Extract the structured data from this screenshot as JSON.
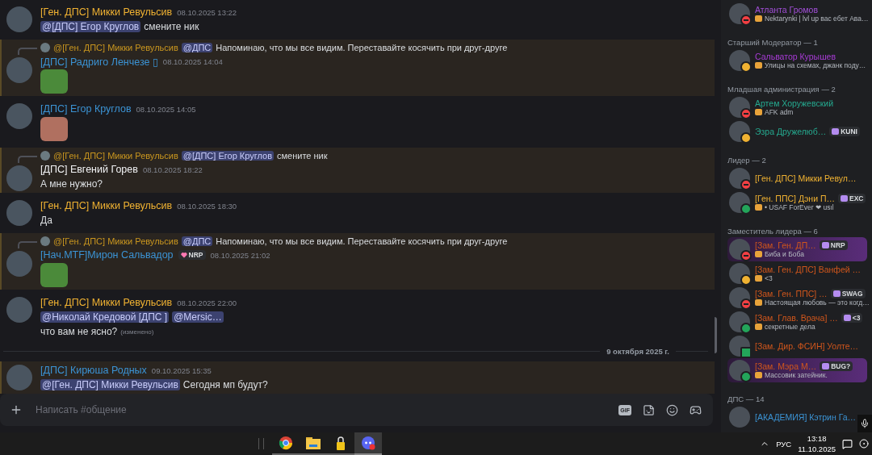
{
  "chat": {
    "messages": [
      {
        "kind": "message",
        "highlighted": false,
        "author": "[Ген. ДПС] Микки Ревульсив",
        "color": "#f0b232",
        "time": "08.10.2025 13:22",
        "lines": [
          [
            {
              "kind": "mention",
              "text": "@[ДПС] Егор Круглов"
            },
            {
              "kind": "text",
              "text": "смените ник"
            }
          ]
        ]
      },
      {
        "kind": "message",
        "highlighted": true,
        "reply": {
          "author": "@[Ген. ДПС] Микки Ревульсив",
          "color": "#c9961f",
          "parts": [
            {
              "kind": "mention",
              "text": "@ДПС"
            },
            {
              "kind": "text",
              "text": "Напоминаю, что мы все видим. Переставайте косячить при друг-друге"
            }
          ]
        },
        "author": "[ДПС] Радриго Ленчезе ▯",
        "color": "#3b93d4",
        "time": "08.10.2025 14:04",
        "lines": [
          [
            {
              "kind": "sticker"
            }
          ]
        ]
      },
      {
        "kind": "message",
        "highlighted": false,
        "author": "[ДПС] Егор Круглов",
        "color": "#3b93d4",
        "time": "08.10.2025 14:05",
        "lines": [
          [
            {
              "kind": "photo"
            }
          ]
        ]
      },
      {
        "kind": "message",
        "highlighted": true,
        "reply": {
          "author": "@[Ген. ДПС] Микки Ревульсив",
          "color": "#c9961f",
          "parts": [
            {
              "kind": "mention",
              "text": "@[ДПС] Егор Круглов"
            },
            {
              "kind": "text",
              "text": "смените ник"
            }
          ]
        },
        "author": "[ДПС] Евгений Горев",
        "color": "#f2f3f5",
        "time": "08.10.2025 18:22",
        "lines": [
          [
            {
              "kind": "text",
              "text": "А мне нужно?"
            }
          ]
        ]
      },
      {
        "kind": "message",
        "highlighted": false,
        "author": "[Ген. ДПС] Микки Ревульсив",
        "color": "#f0b232",
        "time": "08.10.2025 18:30",
        "lines": [
          [
            {
              "kind": "text",
              "text": "Да"
            }
          ]
        ]
      },
      {
        "kind": "message",
        "highlighted": true,
        "reply": {
          "author": "@[Ген. ДПС] Микки Ревульсив",
          "color": "#c9961f",
          "parts": [
            {
              "kind": "mention",
              "text": "@ДПС"
            },
            {
              "kind": "text",
              "text": "Напоминаю, что мы все видим. Переставайте косячить при друг-друге"
            }
          ]
        },
        "author": "[Нач.MTF]Мирон Сальвадор",
        "color": "#3b93d4",
        "badge": "NRP",
        "time": "08.10.2025 21:02",
        "lines": [
          [
            {
              "kind": "sticker"
            }
          ]
        ]
      },
      {
        "kind": "message",
        "highlighted": false,
        "author": "[Ген. ДПС] Микки Ревульсив",
        "color": "#f0b232",
        "time": "08.10.2025 22:00",
        "lines": [
          [
            {
              "kind": "mention",
              "text": "@Николай Кредовой [ДПС ]"
            },
            {
              "kind": "mention",
              "text": "@Mersic…"
            }
          ],
          [
            {
              "kind": "text",
              "text": "что вам не ясно?"
            },
            {
              "kind": "edited",
              "text": "(изменено)"
            }
          ]
        ]
      },
      {
        "kind": "divider",
        "label": "9 октября 2025 г."
      },
      {
        "kind": "message",
        "highlighted": true,
        "author": "[ДПС] Кирюша Родных",
        "color": "#3b93d4",
        "time": "09.10.2025 15:35",
        "lines": [
          [
            {
              "kind": "mention",
              "text": "@[Ген. ДПС] Микки Ревульсив"
            },
            {
              "kind": "text",
              "text": "Сегодня мп будут?"
            }
          ]
        ]
      }
    ],
    "input": {
      "placeholder": "Написать #общение",
      "gif_label": "GIF"
    }
  },
  "member_list": {
    "sections": [
      {
        "members": [
          {
            "name": "Атланта Громов",
            "color": "#a24fd8",
            "status": "Nektarynki | lvl up вас ебет Ава…",
            "kind": "dnd",
            "highlighted": false
          }
        ]
      },
      {
        "title": "Старший Модератор — 1",
        "members": [
          {
            "name": "Сальватор Курышев",
            "color": "#a83bd6",
            "status": "Улицы на схемах, джанк поду…",
            "kind": "idle",
            "highlighted": false
          }
        ]
      },
      {
        "title": "Младшая администрация — 2",
        "members": [
          {
            "name": "Артем Хоружевский",
            "color": "#25a98f",
            "status": "AFK adm",
            "kind": "dnd",
            "highlighted": false
          },
          {
            "name": "Эзра Дружелюб…",
            "color": "#25a98f",
            "badge": "KUNI",
            "kind": "idle",
            "highlighted": false
          }
        ]
      },
      {
        "title": "Лидер — 2",
        "members": [
          {
            "name": "[Ген. ДПС] Микки Ревул…",
            "color": "#f0b232",
            "kind": "dnd",
            "highlighted": false
          },
          {
            "name": "[Ген. ППС] Дэни П…",
            "color": "#f0b232",
            "badge": "EXC",
            "status": "• USAF ForEver ❤ usıl",
            "kind": "online",
            "highlighted": false
          }
        ]
      },
      {
        "title": "Заместитель лидера — 6",
        "members": [
          {
            "name": "[Зам. Ген. ДП…",
            "color": "#d0561c",
            "badge": "NRP",
            "status": "Биба и Боба",
            "kind": "dnd",
            "highlighted": true
          },
          {
            "name": "[Зам. Ген. ДПС] Ванфей …",
            "color": "#d0561c",
            "status": "<3",
            "kind": "idle",
            "highlighted": false
          },
          {
            "name": "[Зам. Ген. ППС] …",
            "color": "#d0561c",
            "badge": "SWAG",
            "status": "Настоящая любовь — это когд…",
            "kind": "dnd",
            "highlighted": false
          },
          {
            "name": "[Зам. Глав. Врача] …",
            "color": "#d0561c",
            "badge": "<3",
            "status": "секретные дела",
            "kind": "online",
            "highlighted": false
          },
          {
            "name": "[Зам. Дир. ФСИН] Уолте…",
            "color": "#d0561c",
            "kind": "mobile",
            "highlighted": false
          },
          {
            "name": "[Зам. Мэра М…",
            "color": "#d0561c",
            "badge": "BUG?",
            "status": "Массовик затейник.",
            "kind": "online",
            "highlighted": true
          }
        ]
      },
      {
        "title": "ДПС — 14",
        "members": [
          {
            "name": "[АКАДЕМИЯ] Кэтрин Га…",
            "color": "#3b93d4",
            "kind": "none",
            "highlighted": false
          }
        ]
      }
    ]
  },
  "taskbar": {
    "language": "РУС",
    "time": "13:18",
    "date": "11.10.2025"
  }
}
